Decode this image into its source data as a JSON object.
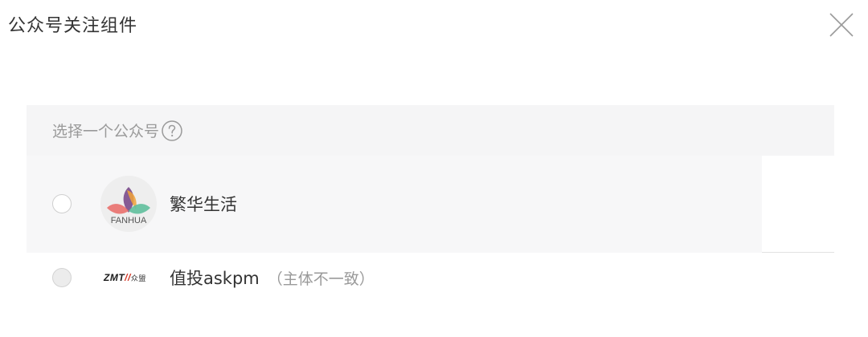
{
  "dialog": {
    "title": "公众号关注组件"
  },
  "panel": {
    "header_label": "选择一个公众号"
  },
  "accounts": [
    {
      "name": "繁华生活",
      "avatar_text": "FANHUA",
      "selectable": true
    },
    {
      "name": "值投askpm",
      "note": "（主体不一致）",
      "logo_text_main": "ZMT",
      "logo_text_accent": "//",
      "logo_text_sub": "众盟",
      "selectable": false
    }
  ],
  "icons": {
    "close": "close-icon",
    "help": "question-circle-icon"
  }
}
